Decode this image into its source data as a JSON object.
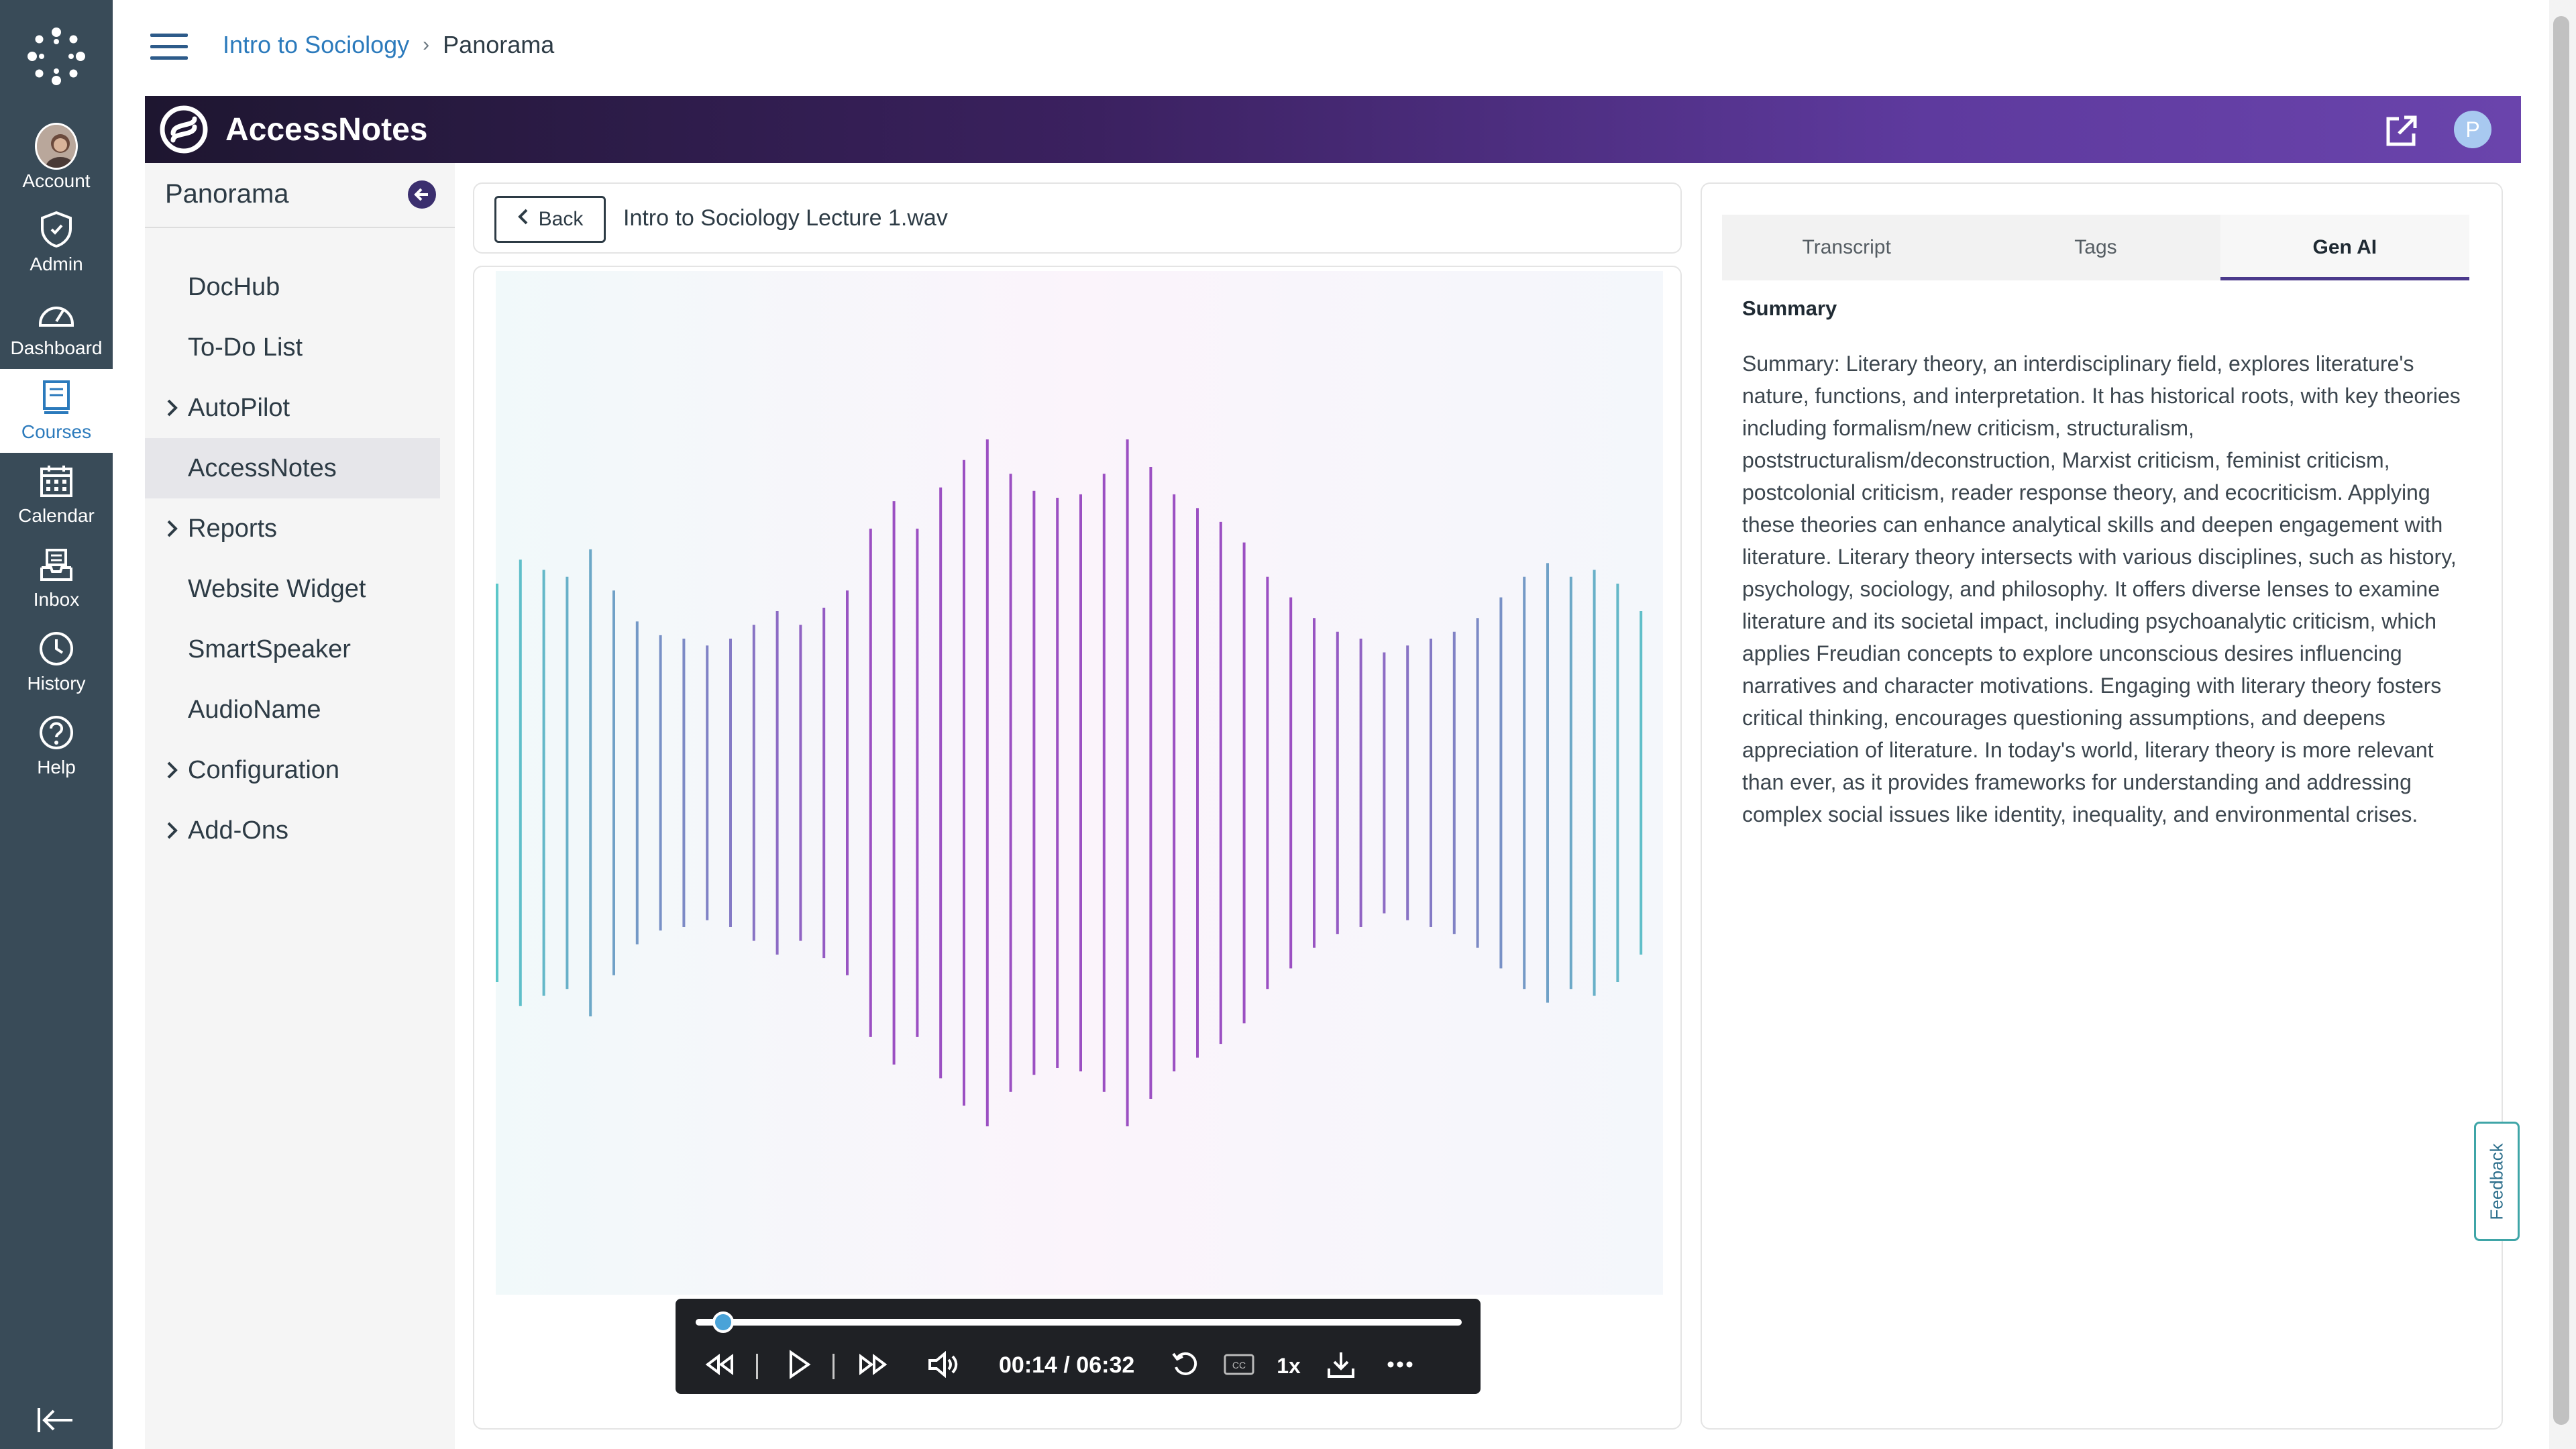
{
  "global_nav": {
    "items": [
      {
        "label": "Account",
        "icon": "account-avatar"
      },
      {
        "label": "Admin",
        "icon": "shield-icon"
      },
      {
        "label": "Dashboard",
        "icon": "dashboard-icon"
      },
      {
        "label": "Courses",
        "icon": "courses-icon"
      },
      {
        "label": "Calendar",
        "icon": "calendar-icon"
      },
      {
        "label": "Inbox",
        "icon": "inbox-icon"
      },
      {
        "label": "History",
        "icon": "clock-icon"
      },
      {
        "label": "Help",
        "icon": "help-icon"
      }
    ],
    "active_index": 3
  },
  "breadcrumb": {
    "course": "Intro to Sociology",
    "separator": "›",
    "current": "Panorama"
  },
  "app_header": {
    "title": "AccessNotes",
    "user_initial": "P"
  },
  "course_nav": {
    "title": "Panorama",
    "items": [
      {
        "label": "DocHub",
        "expandable": false
      },
      {
        "label": "To-Do List",
        "expandable": false
      },
      {
        "label": "AutoPilot",
        "expandable": true
      },
      {
        "label": "AccessNotes",
        "expandable": false,
        "active": true
      },
      {
        "label": "Reports",
        "expandable": true
      },
      {
        "label": "Website Widget",
        "expandable": false
      },
      {
        "label": "SmartSpeaker",
        "expandable": false
      },
      {
        "label": "AudioName",
        "expandable": false
      },
      {
        "label": "Configuration",
        "expandable": true
      },
      {
        "label": "Add-Ons",
        "expandable": true
      }
    ]
  },
  "file_bar": {
    "back_label": "Back",
    "file_name": "Intro to Sociology Lecture 1.wav"
  },
  "player": {
    "time_display": "00:14 / 06:32",
    "progress_fraction": 0.036,
    "speed_label": "1x",
    "waveform_levels": [
      0.58,
      0.65,
      0.62,
      0.6,
      0.68,
      0.56,
      0.47,
      0.43,
      0.42,
      0.4,
      0.42,
      0.46,
      0.5,
      0.46,
      0.51,
      0.56,
      0.74,
      0.82,
      0.74,
      0.86,
      0.94,
      1.0,
      0.9,
      0.85,
      0.83,
      0.84,
      0.9,
      1.0,
      0.92,
      0.84,
      0.8,
      0.76,
      0.7,
      0.6,
      0.54,
      0.48,
      0.44,
      0.42,
      0.38,
      0.4,
      0.42,
      0.44,
      0.48,
      0.54,
      0.6,
      0.64,
      0.6,
      0.62,
      0.58,
      0.5,
      0.44
    ],
    "accent_colors": [
      "#5cc7c9",
      "#9b4fc2"
    ]
  },
  "right_panel": {
    "tabs": [
      {
        "label": "Transcript",
        "active": false
      },
      {
        "label": "Tags",
        "active": false
      },
      {
        "label": "Gen AI",
        "active": true
      }
    ],
    "summary_heading": "Summary",
    "summary_text": "Summary: Literary theory, an interdisciplinary field, explores literature's nature, functions, and interpretation. It has historical roots, with key theories including formalism/new criticism, structuralism, poststructuralism/deconstruction, Marxist criticism, feminist criticism, postcolonial criticism, reader response theory, and ecocriticism. Applying these theories can enhance analytical skills and deepen engagement with literature. Literary theory intersects with various disciplines, such as history, psychology, sociology, and philosophy. It offers diverse lenses to examine literature and its societal impact, including psychoanalytic criticism, which applies Freudian concepts to explore unconscious desires influencing narratives and character motivations. Engaging with literary theory fosters critical thinking, encourages questioning assumptions, and deepens appreciation of literature. In today's world, literary theory is more relevant than ever, as it provides frameworks for understanding and addressing complex social issues like identity, inequality, and environmental crises."
  },
  "feedback_label": "Feedback",
  "colors": {
    "global_nav_bg": "#394b58",
    "link_blue": "#2b7abc",
    "header_gradient_start": "#1e1630",
    "header_gradient_end": "#6a44ac",
    "tab_underline": "#4b3a8c"
  }
}
